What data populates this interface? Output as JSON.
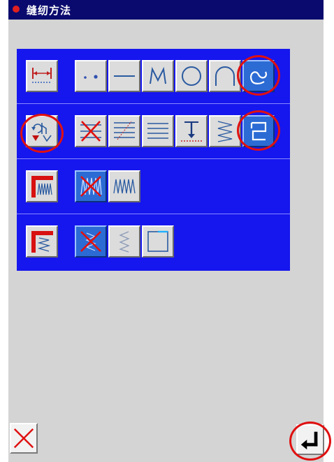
{
  "title": "缝纫方法",
  "colors": {
    "title_bg": "#0a0a6e",
    "panel_bg": "#1616ee",
    "screen_bg": "#d4d4d4",
    "highlight_ring": "#e01010",
    "selected_button": "#2c6bd4"
  },
  "rows": [
    {
      "name": "sewing-start-end",
      "mode_icon": "span-length-icon",
      "options": [
        "dots-icon",
        "straight-line-icon",
        "m-shape-icon",
        "circle-icon",
        "arc-icon",
        "free-curve-icon"
      ],
      "selected": "free-curve-icon"
    },
    {
      "name": "feed-method",
      "mode_icon": "reverse-feed-icon",
      "options": [
        "no-stitch-x-icon",
        "multi-line-feed-icon",
        "parallel-lines-icon",
        "needle-drop-icon",
        "zigzag-icon",
        "box-return-icon"
      ],
      "selected": "box-return-icon"
    },
    {
      "name": "corner-zigzag",
      "mode_icon": "corner-zigzag-icon",
      "options": [
        "zigzag-off-icon",
        "zigzag-on-icon"
      ],
      "selected": "zigzag-off-icon"
    },
    {
      "name": "corner-pattern",
      "mode_icon": "corner-pattern-icon",
      "options": [
        "pattern-off-icon",
        "w-pattern-icon",
        "square-pattern-icon"
      ],
      "selected": "pattern-off-icon"
    }
  ],
  "buttons": {
    "cancel": "cancel-x-icon",
    "enter": "enter-return-icon"
  }
}
